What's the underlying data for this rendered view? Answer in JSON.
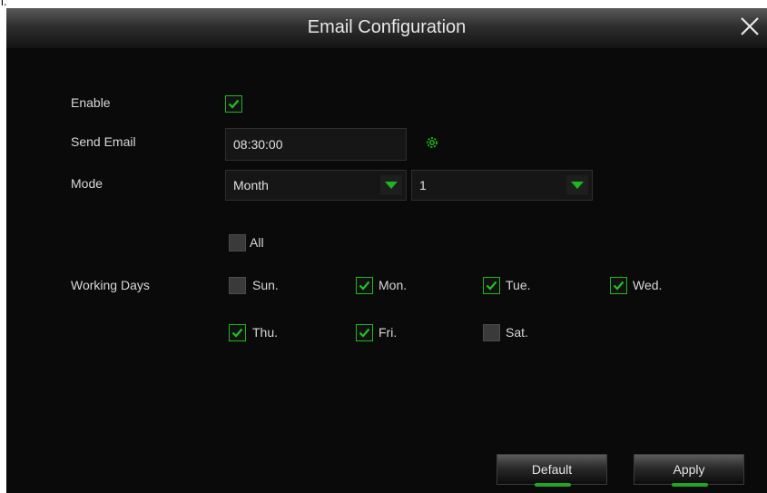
{
  "corner_text": "l.",
  "dialog": {
    "title": "Email Configuration",
    "close_icon": "close-icon"
  },
  "form": {
    "enable": {
      "label": "Enable",
      "checked": true
    },
    "send_email": {
      "label": "Send Email",
      "value": "08:30:00",
      "icon": "gear-icon"
    },
    "mode": {
      "label": "Mode",
      "select1": "Month",
      "select2": "1"
    },
    "working_days": {
      "label": "Working Days",
      "all": {
        "label": "All",
        "checked": false
      },
      "days": [
        {
          "label": "Sun.",
          "checked": false
        },
        {
          "label": "Mon.",
          "checked": true
        },
        {
          "label": "Tue.",
          "checked": true
        },
        {
          "label": "Wed.",
          "checked": true
        },
        {
          "label": "Thu.",
          "checked": true
        },
        {
          "label": "Fri.",
          "checked": true
        },
        {
          "label": "Sat.",
          "checked": false
        }
      ]
    }
  },
  "buttons": {
    "default": "Default",
    "apply": "Apply"
  },
  "colors": {
    "accent": "#1fb51f",
    "background": "#0a0a0a",
    "text": "#d8d8d8"
  }
}
